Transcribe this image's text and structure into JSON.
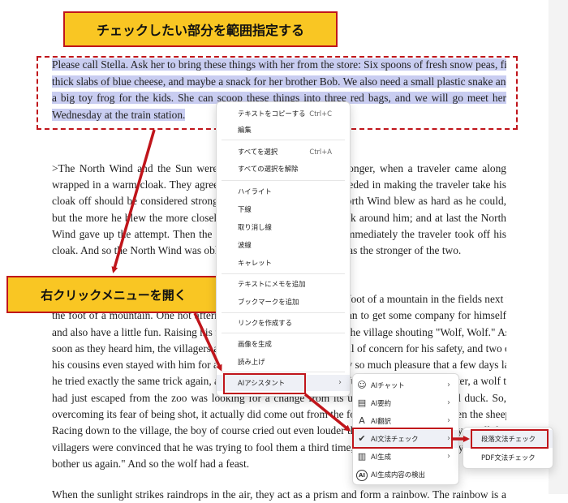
{
  "callouts": {
    "top": "チェックしたい部分を範囲指定する",
    "middle": "右クリックメニューを開く"
  },
  "document": {
    "selected_lines": [
      "Please call Stella. Ask her to bring these things with her from the store: Six spoons of fresh snow peas, five",
      "thick slabs of blue cheese, and maybe a snack for her brother Bob. We also need a small plastic snake and a",
      "a big toy frog for the kids. She can scoop these things into three red bags, and we will go meet her",
      "Wednesday at the train station."
    ],
    "para2_lines": [
      ">The North Wind and the Sun were disputing which was the stronger, when a traveler came along",
      "wrapped in a warm cloak. They agreed that the one who first succeeded in making the traveler take his",
      "cloak off should be considered stronger than the other. Then the North Wind blew as hard as he could,",
      "but the more he blew the more closely did the traveler fold his cloak around him; and at last the North",
      "Wind gave up the attempt. Then the Sun shined out warmly, and immediately the traveler took off his",
      "cloak. And so the North Wind was obliged to confess that the Sun was the stronger of the two."
    ],
    "para3_lines": [
      "There was once a young Shepherd Boy who tended his sheep at the foot of a mountain in the fields next to a dark forest near",
      "the foot of a mountain. One hot afternoon, he thought up a good plan to get some company for himself",
      "and also have a little fun. Raising his fists in the air, he ran down to the village shouting \"Wolf, Wolf.\" As",
      "soon as they heard him, the villagers all rushed from their homes, full of concern for his safety, and two of",
      "his cousins even stayed with him for a short while. This gave the boy so much pleasure that a few days later",
      "he tried exactly the same trick again, and once again he was successful. However, not long after, a wolf that",
      "had just escaped from the zoo was looking for a change from its usual diet of chicken and duck. So,",
      "overcoming its fear of being shot, it actually did come out from the forest and began to threaten the sheep.",
      "Racing down to the village, the boy of course cried out even louder than before. Unfortunately, as all the",
      "villagers were convinced that he was trying to fool them a third time, they told him, \"Go away and don't",
      "bother us again.\" And so the wolf had a feast."
    ],
    "para4_line": "When the sunlight strikes raindrops in the air, they act as a prism and form a rainbow. The rainbow is a"
  },
  "context_menu": {
    "groups": [
      [
        {
          "label": "テキストをコピーする",
          "shortcut": "Ctrl+C"
        },
        {
          "label": "編集",
          "shortcut": ""
        }
      ],
      [
        {
          "label": "すべてを選択",
          "shortcut": "Ctrl+A"
        },
        {
          "label": "すべての選択を解除",
          "shortcut": ""
        }
      ],
      [
        {
          "label": "ハイライト"
        },
        {
          "label": "下線"
        },
        {
          "label": "取り消し線"
        },
        {
          "label": "波線"
        },
        {
          "label": "キャレット"
        }
      ],
      [
        {
          "label": "テキストにメモを追加"
        },
        {
          "label": "ブックマークを追加"
        }
      ],
      [
        {
          "label": "リンクを作成する"
        }
      ],
      [
        {
          "label": "画像を生成"
        },
        {
          "label": "読み上げ"
        }
      ],
      [
        {
          "label": "AIアシスタント",
          "arrow": "›"
        }
      ]
    ]
  },
  "ai_submenu": {
    "items": [
      {
        "label": "AIチャット",
        "icon": "chat-icon",
        "glyph": "☺",
        "arrow": "›"
      },
      {
        "label": "AI要約",
        "icon": "summary-icon",
        "glyph": "▤",
        "arrow": "›"
      },
      {
        "label": "AI翻訳",
        "icon": "translate-icon",
        "glyph": "A",
        "arrow": "›"
      },
      {
        "label": "AI文法チェック",
        "icon": "grammar-check-icon",
        "glyph": "✔",
        "arrow": "›"
      },
      {
        "label": "AI生成",
        "icon": "generate-icon",
        "glyph": "▥",
        "arrow": "›"
      },
      {
        "label": "AI生成内容の検出",
        "icon": "ai-detect-icon",
        "glyph": "AI",
        "arrow": ""
      }
    ]
  },
  "grammar_submenu": {
    "items": [
      "段落文法チェック",
      "PDF文法チェック"
    ]
  },
  "colors": {
    "callout_fill": "#f9c623",
    "accent_red": "#c0151b",
    "selection": "#c9cdf1"
  }
}
